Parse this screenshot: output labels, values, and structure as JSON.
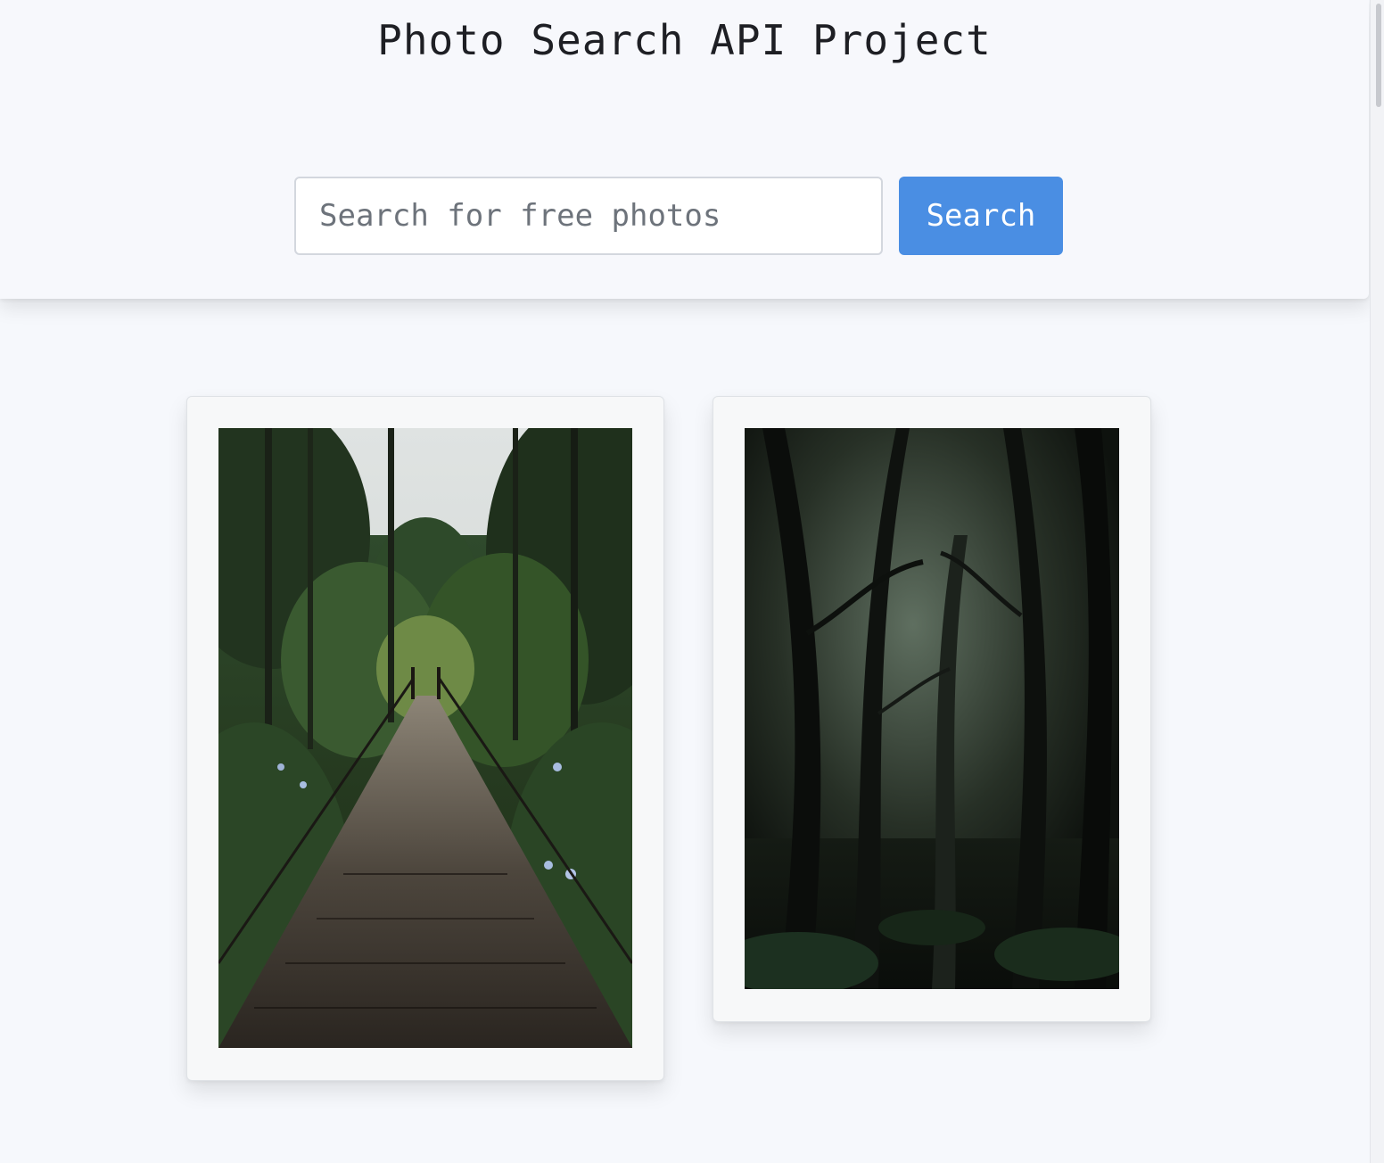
{
  "header": {
    "title": "Photo Search API Project",
    "search_placeholder": "Search for free photos",
    "search_value": "",
    "search_button_label": "Search"
  },
  "results": [
    {
      "description": "forest-suspension-bridge-photo"
    },
    {
      "description": "dark-misty-forest-photo"
    }
  ],
  "colors": {
    "accent": "#4a8ee3",
    "background": "#f6f8fc"
  }
}
